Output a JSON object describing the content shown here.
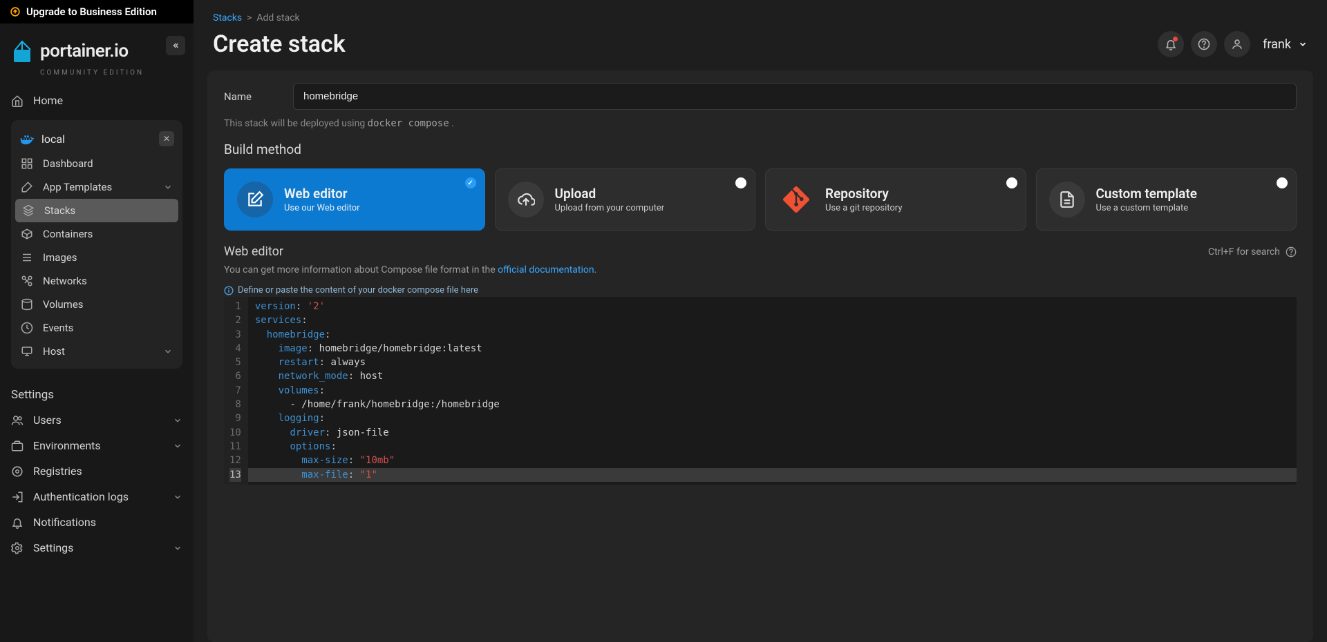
{
  "upgrade_banner": "Upgrade to Business Edition",
  "logo": {
    "name": "portainer.io",
    "edition": "COMMUNITY EDITION"
  },
  "sidebar": {
    "home": "Home",
    "environment": {
      "name": "local",
      "items": [
        {
          "label": "Dashboard",
          "icon": "dashboard-icon"
        },
        {
          "label": "App Templates",
          "icon": "template-icon",
          "expandable": true
        },
        {
          "label": "Stacks",
          "icon": "stacks-icon",
          "active": true
        },
        {
          "label": "Containers",
          "icon": "containers-icon"
        },
        {
          "label": "Images",
          "icon": "images-icon"
        },
        {
          "label": "Networks",
          "icon": "networks-icon"
        },
        {
          "label": "Volumes",
          "icon": "volumes-icon"
        },
        {
          "label": "Events",
          "icon": "events-icon"
        },
        {
          "label": "Host",
          "icon": "host-icon",
          "expandable": true
        }
      ]
    },
    "settings_heading": "Settings",
    "settings_items": [
      {
        "label": "Users",
        "icon": "users-icon",
        "expandable": true
      },
      {
        "label": "Environments",
        "icon": "environments-icon",
        "expandable": true
      },
      {
        "label": "Registries",
        "icon": "registries-icon"
      },
      {
        "label": "Authentication logs",
        "icon": "auth-icon",
        "expandable": true
      },
      {
        "label": "Notifications",
        "icon": "bell-icon"
      },
      {
        "label": "Settings",
        "icon": "gear-icon",
        "expandable": true
      }
    ]
  },
  "breadcrumb": {
    "root": "Stacks",
    "sep": ">",
    "current": "Add stack"
  },
  "page_title": "Create stack",
  "user": {
    "name": "frank"
  },
  "form": {
    "name_label": "Name",
    "name_value": "homebridge",
    "deploy_note_prefix": "This stack will be deployed using ",
    "deploy_note_code": "docker compose",
    "deploy_note_suffix": " ."
  },
  "build_method": {
    "heading": "Build method",
    "options": [
      {
        "title": "Web editor",
        "subtitle": "Use our Web editor",
        "selected": true,
        "icon": "edit-icon"
      },
      {
        "title": "Upload",
        "subtitle": "Upload from your computer",
        "selected": false,
        "icon": "cloud-upload-icon"
      },
      {
        "title": "Repository",
        "subtitle": "Use a git repository",
        "selected": false,
        "icon": "git-icon"
      },
      {
        "title": "Custom template",
        "subtitle": "Use a custom template",
        "selected": false,
        "icon": "file-icon"
      }
    ]
  },
  "editor": {
    "title": "Web editor",
    "search_hint": "Ctrl+F for search",
    "info_prefix": "You can get more information about Compose file format in the ",
    "info_link": "official documentation",
    "info_suffix": ".",
    "placeholder": "Define or paste the content of your docker compose file here",
    "current_line": 13,
    "lines": [
      [
        [
          "key",
          "version"
        ],
        [
          "punct",
          ": "
        ],
        [
          "str",
          "'2'"
        ]
      ],
      [
        [
          "key",
          "services"
        ],
        [
          "punct",
          ":"
        ]
      ],
      [
        [
          "plain",
          "  "
        ],
        [
          "key",
          "homebridge"
        ],
        [
          "punct",
          ":"
        ]
      ],
      [
        [
          "plain",
          "    "
        ],
        [
          "key",
          "image"
        ],
        [
          "punct",
          ": "
        ],
        [
          "plain",
          "homebridge/homebridge:latest"
        ]
      ],
      [
        [
          "plain",
          "    "
        ],
        [
          "key",
          "restart"
        ],
        [
          "punct",
          ": "
        ],
        [
          "plain",
          "always"
        ]
      ],
      [
        [
          "plain",
          "    "
        ],
        [
          "key",
          "network_mode"
        ],
        [
          "punct",
          ": "
        ],
        [
          "plain",
          "host"
        ]
      ],
      [
        [
          "plain",
          "    "
        ],
        [
          "key",
          "volumes"
        ],
        [
          "punct",
          ":"
        ]
      ],
      [
        [
          "plain",
          "      - /home/frank/homebridge:/homebridge"
        ]
      ],
      [
        [
          "plain",
          "    "
        ],
        [
          "key",
          "logging"
        ],
        [
          "punct",
          ":"
        ]
      ],
      [
        [
          "plain",
          "      "
        ],
        [
          "key",
          "driver"
        ],
        [
          "punct",
          ": "
        ],
        [
          "plain",
          "json-file"
        ]
      ],
      [
        [
          "plain",
          "      "
        ],
        [
          "key",
          "options"
        ],
        [
          "punct",
          ":"
        ]
      ],
      [
        [
          "plain",
          "        "
        ],
        [
          "key",
          "max-size"
        ],
        [
          "punct",
          ": "
        ],
        [
          "str",
          "\"10mb\""
        ]
      ],
      [
        [
          "plain",
          "        "
        ],
        [
          "key",
          "max-file"
        ],
        [
          "punct",
          ": "
        ],
        [
          "str",
          "\"1\""
        ]
      ]
    ]
  }
}
